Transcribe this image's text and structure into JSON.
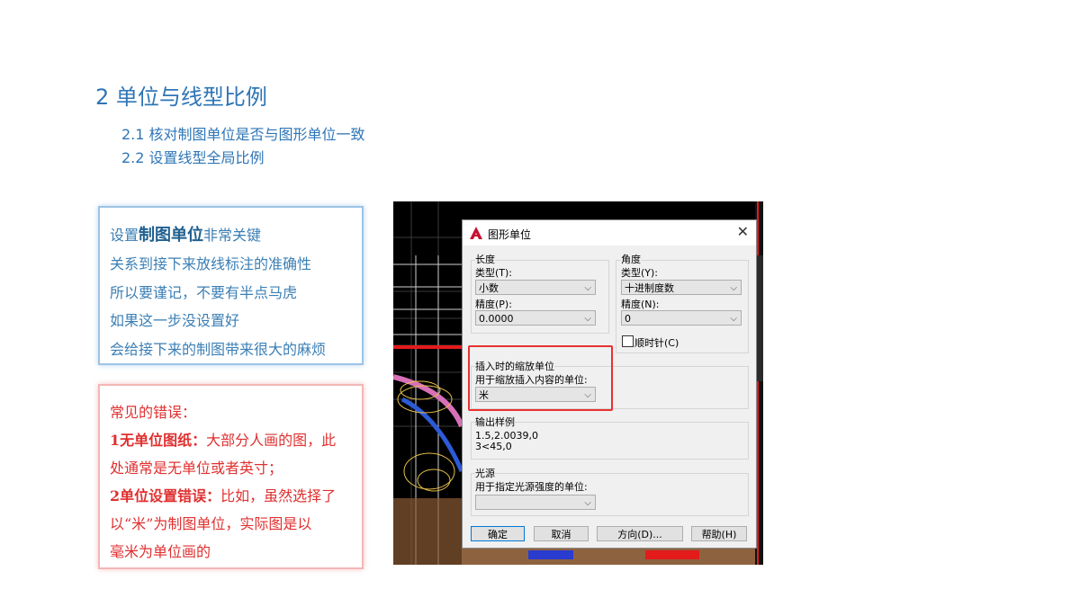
{
  "slide": {
    "title": "2 单位与线型比例",
    "items": [
      "2.1 核对制图单位是否与图形单位一致",
      "2.2 设置线型全局比例"
    ]
  },
  "blue_box": {
    "line1_prefix": "设置",
    "line1_strong": "制图单位",
    "line1_suffix": "非常关键",
    "line2": "关系到接下来放线标注的准确性",
    "line3": "所以要谨记，不要有半点马虎",
    "line4": "如果这一步没设置好",
    "line5": "会给接下来的制图带来很大的麻烦"
  },
  "red_box": {
    "heading": "常见的错误：",
    "e1_bold": "1无单位图纸：",
    "e1_text": "大部分人画的图，此",
    "e1_text2": "处通常是无单位或者英寸；",
    "e2_bold": "2单位设置错误：",
    "e2_text": "比如，虽然选择了",
    "e2_text2": "以“米”为制图单位，实际图是以",
    "e2_text3": "毫米为单位画的"
  },
  "dialog": {
    "title": "图形单位",
    "close": "✕",
    "length": {
      "group": "长度",
      "type_label": "类型(T):",
      "type_value": "小数",
      "precision_label": "精度(P):",
      "precision_value": "0.0000"
    },
    "angle": {
      "group": "角度",
      "type_label": "类型(Y):",
      "type_value": "十进制度数",
      "precision_label": "精度(N):",
      "precision_value": "0",
      "clockwise_label": "顺时针(C)"
    },
    "insert": {
      "group": "插入时的缩放单位",
      "label": "用于缩放插入内容的单位:",
      "value": "米"
    },
    "output": {
      "group": "输出样例",
      "line1": "1.5,2.0039,0",
      "line2": "3<45,0"
    },
    "light": {
      "group": "光源",
      "label": "用于指定光源强度的单位:",
      "value": ""
    },
    "buttons": {
      "ok": "确定",
      "cancel": "取消",
      "direction": "方向(D)...",
      "help": "帮助(H)"
    }
  },
  "colors": {
    "title_blue": "#2E75B6",
    "error_red": "#E03030",
    "highlight_red": "#E8312F",
    "autocad_red": "#C8102E"
  }
}
